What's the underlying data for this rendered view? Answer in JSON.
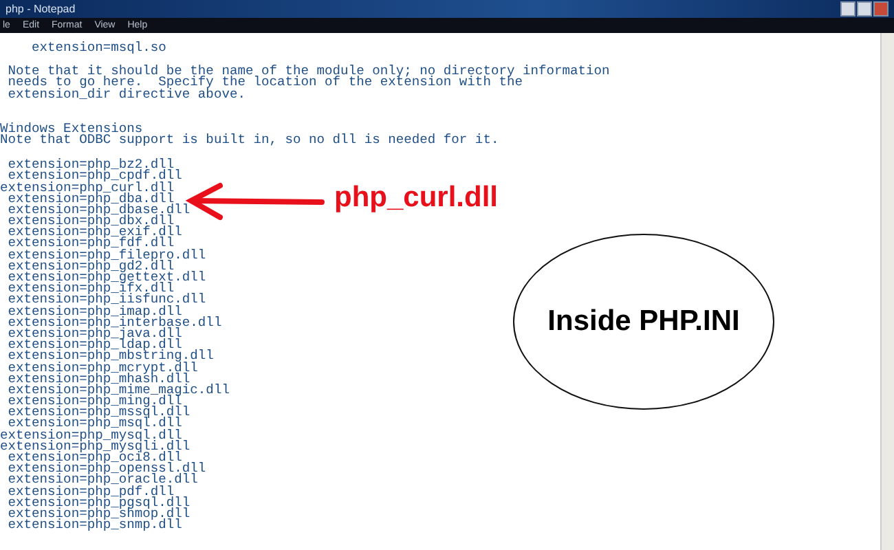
{
  "window": {
    "title": "php - Notepad"
  },
  "menu": [
    "le",
    "Edit",
    "Format",
    "View",
    "Help"
  ],
  "editor_blocks": [
    {
      "lines": [
        "    extension=msql.so"
      ]
    },
    {
      "lines": [
        " Note that it should be the name of the module only; no directory information",
        " needs to go here.  Specify the location of the extension with the",
        " extension_dir directive above."
      ]
    },
    {
      "lines": [
        "Windows Extensions",
        "Note that ODBC support is built in, so no dll is needed for it."
      ]
    },
    {
      "lines": [
        " extension=php_bz2.dll",
        " extension=php_cpdf.dll",
        "extension=php_curl.dll",
        " extension=php_dba.dll",
        " extension=php_dbase.dll",
        " extension=php_dbx.dll",
        " extension=php_exif.dll",
        " extension=php_fdf.dll",
        " extension=php_filepro.dll",
        " extension=php_gd2.dll",
        " extension=php_gettext.dll",
        " extension=php_ifx.dll",
        " extension=php_iisfunc.dll",
        " extension=php_imap.dll",
        " extension=php_interbase.dll",
        " extension=php_java.dll",
        " extension=php_ldap.dll",
        " extension=php_mbstring.dll",
        " extension=php_mcrypt.dll",
        " extension=php_mhash.dll",
        " extension=php_mime_magic.dll",
        " extension=php_ming.dll",
        " extension=php_mssql.dll",
        " extension=php_msql.dll",
        "extension=php_mysql.dll",
        "extension=php_mysqli.dll",
        " extension=php_oci8.dll",
        " extension=php_openssl.dll",
        " extension=php_oracle.dll",
        " extension=php_pdf.dll",
        " extension=php_pgsql.dll",
        " extension=php_shmop.dll",
        " extension=php_snmp.dll"
      ]
    }
  ],
  "annotations": {
    "arrow_label": "php_curl.dll",
    "ellipse_label": "Inside PHP.INI"
  }
}
